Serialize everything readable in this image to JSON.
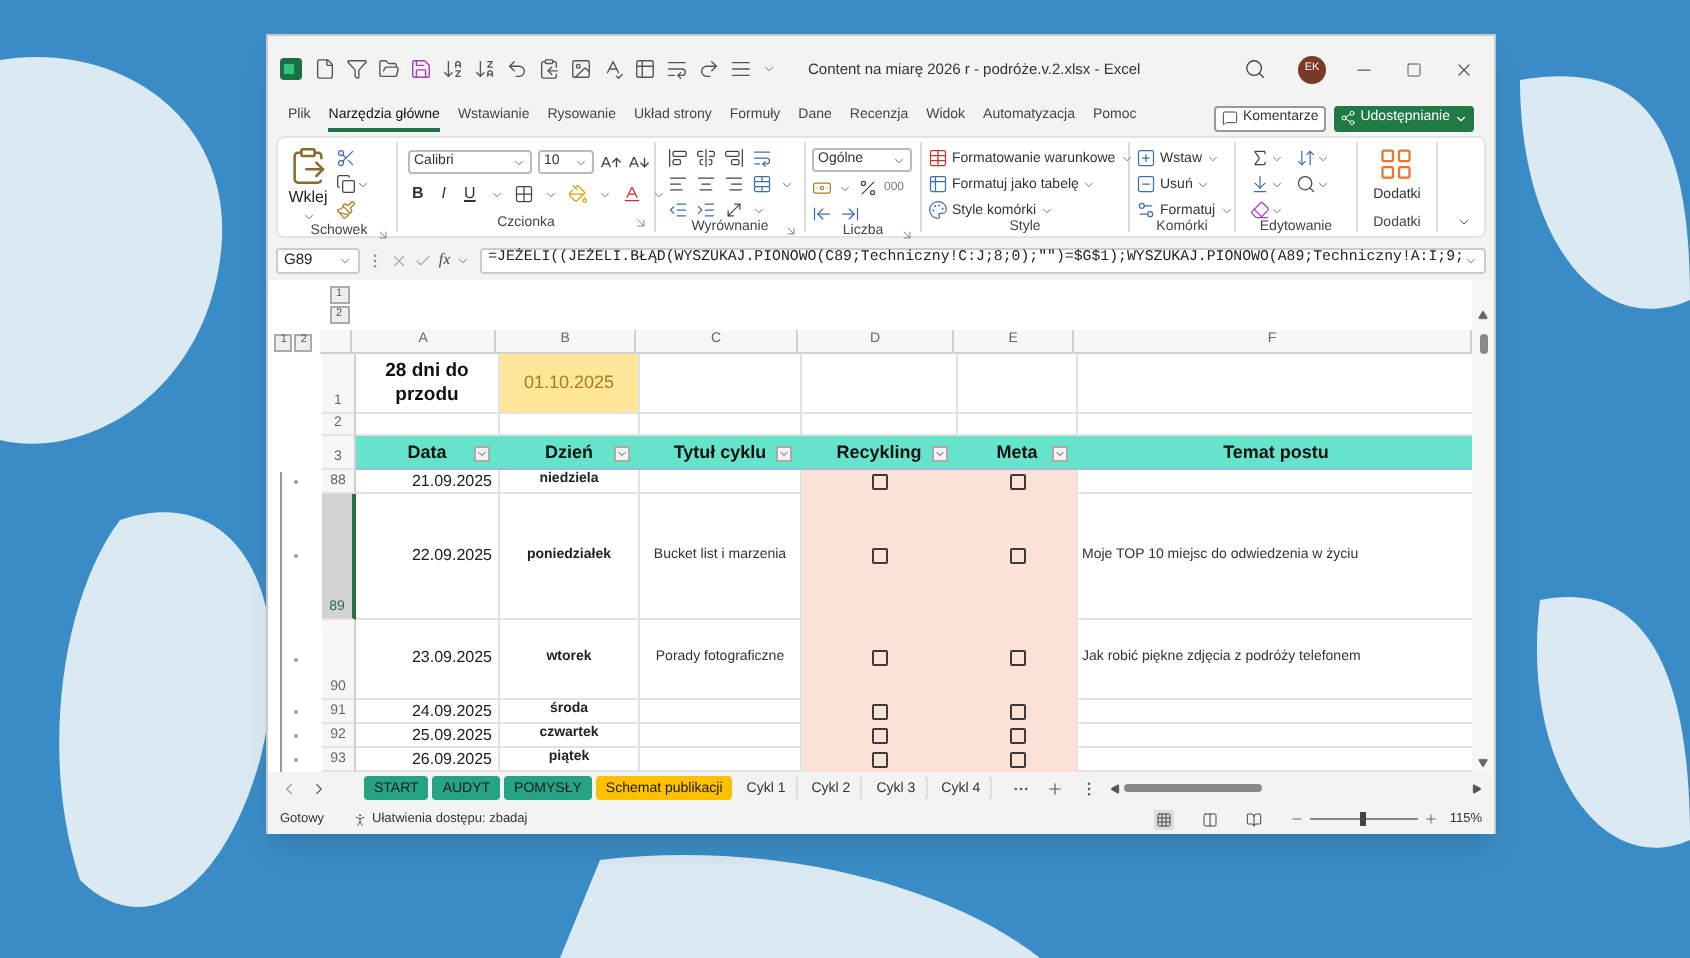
{
  "window": {
    "title": "Content na miarę 2026 r - podróże.v.2.xlsx - Excel",
    "avatar": "EK"
  },
  "menu_tabs": [
    {
      "label": "Plik",
      "selected": false
    },
    {
      "label": "Narzędzia główne",
      "selected": true
    },
    {
      "label": "Wstawianie",
      "selected": false
    },
    {
      "label": "Rysowanie",
      "selected": false
    },
    {
      "label": "Układ strony",
      "selected": false
    },
    {
      "label": "Formuły",
      "selected": false
    },
    {
      "label": "Dane",
      "selected": false
    },
    {
      "label": "Recenzja",
      "selected": false
    },
    {
      "label": "Widok",
      "selected": false
    },
    {
      "label": "Automatyzacja",
      "selected": false
    },
    {
      "label": "Pomoc",
      "selected": false
    }
  ],
  "comments_button": "Komentarze",
  "share_button": "Udostępnianie",
  "ribbon": [
    {
      "kind": "clipboard",
      "label": "Schowek",
      "paste": "Wklej"
    },
    {
      "kind": "font",
      "label": "Czcionka",
      "font": "Calibri",
      "size": "10",
      "styles": [
        "B",
        "I",
        "U"
      ]
    },
    {
      "kind": "alignment",
      "label": "Wyrównanie"
    },
    {
      "kind": "number",
      "label": "Liczba",
      "format": "Ogólne",
      "thousands": "000"
    },
    {
      "kind": "styles",
      "label": "Style",
      "items": [
        "Formatowanie warunkowe",
        "Formatuj jako tabelę",
        "Style komórki"
      ]
    },
    {
      "kind": "cells",
      "label": "Komórki",
      "items": [
        "Wstaw",
        "Usuń",
        "Formatuj"
      ]
    },
    {
      "kind": "editing",
      "label": "Edytowanie"
    },
    {
      "kind": "addins",
      "label": "Dodatki",
      "button": "Dodatki"
    }
  ],
  "formula_bar": {
    "name_box": "G89",
    "function_label": "fx",
    "formula": "=JEŻELI((JEŻELI.BŁĄD(WYSZUKAJ.PIONOWO(C89;Techniczny!C:J;8;0);\"\")=$G$1);WYSZUKAJ.PIONOWO(A89;Techniczny!A:I;9;"
  },
  "column_outline_levels": [
    "1",
    "2"
  ],
  "row_outline_levels": [
    "1",
    "2"
  ],
  "columns": [
    "A",
    "B",
    "C",
    "D",
    "E",
    "F"
  ],
  "rows": [
    {
      "number": "1",
      "kind": "title",
      "selected": false,
      "title": "28 dni do przodu",
      "start_date": "01.10.2025"
    },
    {
      "number": "2",
      "kind": "blank",
      "selected": false
    },
    {
      "number": "3",
      "kind": "header",
      "selected": false,
      "cells": [
        {
          "label": "Data",
          "filter": true
        },
        {
          "label": "Dzień",
          "filter": true
        },
        {
          "label": "Tytuł cyklu",
          "filter": true
        },
        {
          "label": "Recykling",
          "filter": true
        },
        {
          "label": "Meta",
          "filter": true
        },
        {
          "label": "Temat postu",
          "filter": false
        }
      ]
    },
    {
      "number": "88",
      "kind": "data",
      "selected": false,
      "date": "21.09.2025",
      "day": "niedziela",
      "recycling": false,
      "meta": false
    },
    {
      "number": "89",
      "kind": "data",
      "selected": true,
      "date": "22.09.2025",
      "day": "poniedziałek",
      "cycle": "Bucket list i marzenia",
      "recycling": false,
      "meta": false,
      "topic": "Moje TOP 10 miejsc do odwiedzenia w życiu"
    },
    {
      "number": "90",
      "kind": "data",
      "selected": false,
      "date": "23.09.2025",
      "day": "wtorek",
      "cycle": "Porady fotograficzne",
      "recycling": false,
      "meta": false,
      "topic": "Jak robić piękne zdjęcia z podróży telefonem"
    },
    {
      "number": "91",
      "kind": "data",
      "selected": false,
      "date": "24.09.2025",
      "day": "środa",
      "recycling": false,
      "meta": false
    },
    {
      "number": "92",
      "kind": "data",
      "selected": false,
      "date": "25.09.2025",
      "day": "czwartek",
      "recycling": false,
      "meta": false
    },
    {
      "number": "93",
      "kind": "data",
      "selected": false,
      "date": "26.09.2025",
      "day": "piątek",
      "recycling": false,
      "meta": false
    }
  ],
  "sheets": [
    {
      "label": "START",
      "color": "#26a383"
    },
    {
      "label": "AUDYT",
      "color": "#26a383"
    },
    {
      "label": "POMYSŁY",
      "color": "#26a383"
    },
    {
      "label": "Schemat publikacji",
      "color": "#ffc000"
    },
    {
      "label": "Cykl 1"
    },
    {
      "label": "Cykl 2"
    },
    {
      "label": "Cykl 3"
    },
    {
      "label": "Cykl 4"
    }
  ],
  "status": {
    "ready": "Gotowy",
    "accessibility": "Ułatwienia dostępu: zbadaj",
    "zoom": {
      "level": 0.5,
      "reading": "115%"
    }
  }
}
